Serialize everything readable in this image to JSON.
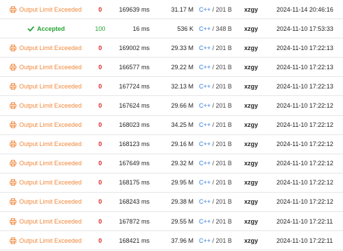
{
  "colors": {
    "output_limit_exceeded": "#f0873a",
    "accepted": "#26a233",
    "score_zero": "#e02424",
    "language_link": "#2f7de1"
  },
  "icons": {
    "output_limit_exceeded": "printer-icon",
    "accepted": "check-icon"
  },
  "rows": [
    {
      "status": "Output Limit Exceeded",
      "status_type": "ole",
      "score": "0",
      "time": "169639 ms",
      "memory": "31.17 M",
      "language": "C++",
      "code_size": "/ 201 B",
      "user": "xzgy",
      "submitted": "2024-11-14 20:46:16"
    },
    {
      "status": "Accepted",
      "status_type": "ac",
      "score": "100",
      "time": "16 ms",
      "memory": "536 K",
      "language": "C++",
      "code_size": "/ 348 B",
      "user": "xzgy",
      "submitted": "2024-11-10 17:53:33"
    },
    {
      "status": "Output Limit Exceeded",
      "status_type": "ole",
      "score": "0",
      "time": "169002 ms",
      "memory": "29.33 M",
      "language": "C++",
      "code_size": "/ 201 B",
      "user": "xzgy",
      "submitted": "2024-11-10 17:22:13"
    },
    {
      "status": "Output Limit Exceeded",
      "status_type": "ole",
      "score": "0",
      "time": "166577 ms",
      "memory": "29.22 M",
      "language": "C++",
      "code_size": "/ 201 B",
      "user": "xzgy",
      "submitted": "2024-11-10 17:22:13"
    },
    {
      "status": "Output Limit Exceeded",
      "status_type": "ole",
      "score": "0",
      "time": "167724 ms",
      "memory": "32.13 M",
      "language": "C++",
      "code_size": "/ 201 B",
      "user": "xzgy",
      "submitted": "2024-11-10 17:22:13"
    },
    {
      "status": "Output Limit Exceeded",
      "status_type": "ole",
      "score": "0",
      "time": "167624 ms",
      "memory": "29.66 M",
      "language": "C++",
      "code_size": "/ 201 B",
      "user": "xzgy",
      "submitted": "2024-11-10 17:22:12"
    },
    {
      "status": "Output Limit Exceeded",
      "status_type": "ole",
      "score": "0",
      "time": "168023 ms",
      "memory": "34.25 M",
      "language": "C++",
      "code_size": "/ 201 B",
      "user": "xzgy",
      "submitted": "2024-11-10 17:22:12"
    },
    {
      "status": "Output Limit Exceeded",
      "status_type": "ole",
      "score": "0",
      "time": "168123 ms",
      "memory": "29.16 M",
      "language": "C++",
      "code_size": "/ 201 B",
      "user": "xzgy",
      "submitted": "2024-11-10 17:22:12"
    },
    {
      "status": "Output Limit Exceeded",
      "status_type": "ole",
      "score": "0",
      "time": "167649 ms",
      "memory": "29.32 M",
      "language": "C++",
      "code_size": "/ 201 B",
      "user": "xzgy",
      "submitted": "2024-11-10 17:22:12"
    },
    {
      "status": "Output Limit Exceeded",
      "status_type": "ole",
      "score": "0",
      "time": "168175 ms",
      "memory": "29.95 M",
      "language": "C++",
      "code_size": "/ 201 B",
      "user": "xzgy",
      "submitted": "2024-11-10 17:22:12"
    },
    {
      "status": "Output Limit Exceeded",
      "status_type": "ole",
      "score": "0",
      "time": "168243 ms",
      "memory": "29.38 M",
      "language": "C++",
      "code_size": "/ 201 B",
      "user": "xzgy",
      "submitted": "2024-11-10 17:22:12"
    },
    {
      "status": "Output Limit Exceeded",
      "status_type": "ole",
      "score": "0",
      "time": "167872 ms",
      "memory": "29.55 M",
      "language": "C++",
      "code_size": "/ 201 B",
      "user": "xzgy",
      "submitted": "2024-11-10 17:22:11"
    },
    {
      "status": "Output Limit Exceeded",
      "status_type": "ole",
      "score": "0",
      "time": "168421 ms",
      "memory": "37.96 M",
      "language": "C++",
      "code_size": "/ 201 B",
      "user": "xzgy",
      "submitted": "2024-11-10 17:22:11"
    }
  ]
}
